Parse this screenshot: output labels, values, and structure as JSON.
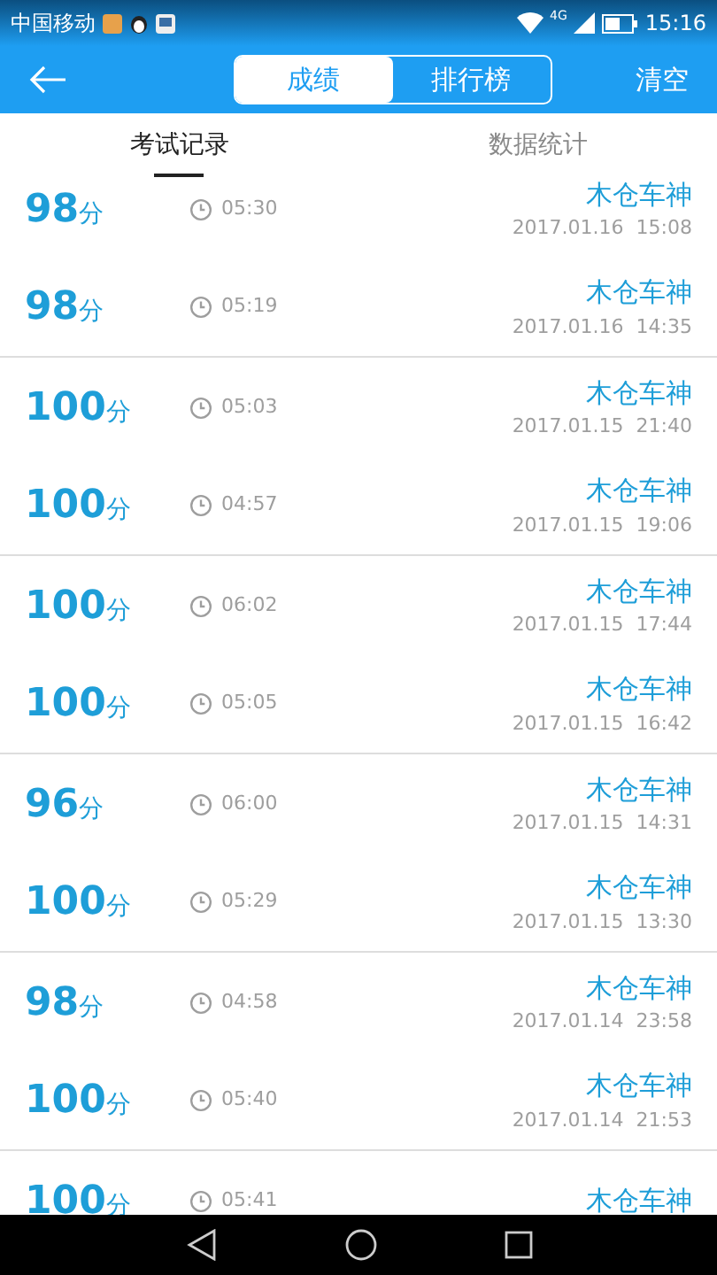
{
  "status_bar": {
    "carrier": "中国移动",
    "network": "4G",
    "time": "15:16"
  },
  "header": {
    "segments": [
      {
        "label": "成绩",
        "selected": true
      },
      {
        "label": "排行榜",
        "selected": false
      }
    ],
    "action": "清空"
  },
  "tabs": [
    {
      "label": "考试记录",
      "selected": true
    },
    {
      "label": "数据统计",
      "selected": false
    }
  ],
  "records": [
    {
      "score": "98",
      "unit": "分",
      "duration": "05:30",
      "name": "木仓车神",
      "date": "2017.01.16  15:08"
    },
    {
      "score": "98",
      "unit": "分",
      "duration": "05:19",
      "name": "木仓车神",
      "date": "2017.01.16  14:35"
    },
    {
      "score": "100",
      "unit": "分",
      "duration": "05:03",
      "name": "木仓车神",
      "date": "2017.01.15  21:40"
    },
    {
      "score": "100",
      "unit": "分",
      "duration": "04:57",
      "name": "木仓车神",
      "date": "2017.01.15  19:06"
    },
    {
      "score": "100",
      "unit": "分",
      "duration": "06:02",
      "name": "木仓车神",
      "date": "2017.01.15  17:44"
    },
    {
      "score": "100",
      "unit": "分",
      "duration": "05:05",
      "name": "木仓车神",
      "date": "2017.01.15  16:42"
    },
    {
      "score": "96",
      "unit": "分",
      "duration": "06:00",
      "name": "木仓车神",
      "date": "2017.01.15  14:31"
    },
    {
      "score": "100",
      "unit": "分",
      "duration": "05:29",
      "name": "木仓车神",
      "date": "2017.01.15  13:30"
    },
    {
      "score": "98",
      "unit": "分",
      "duration": "04:58",
      "name": "木仓车神",
      "date": "2017.01.14  23:58"
    },
    {
      "score": "100",
      "unit": "分",
      "duration": "05:40",
      "name": "木仓车神",
      "date": "2017.01.14  21:53"
    },
    {
      "score": "100",
      "unit": "分",
      "duration": "05:41",
      "name": "木仓车神"
    }
  ]
}
